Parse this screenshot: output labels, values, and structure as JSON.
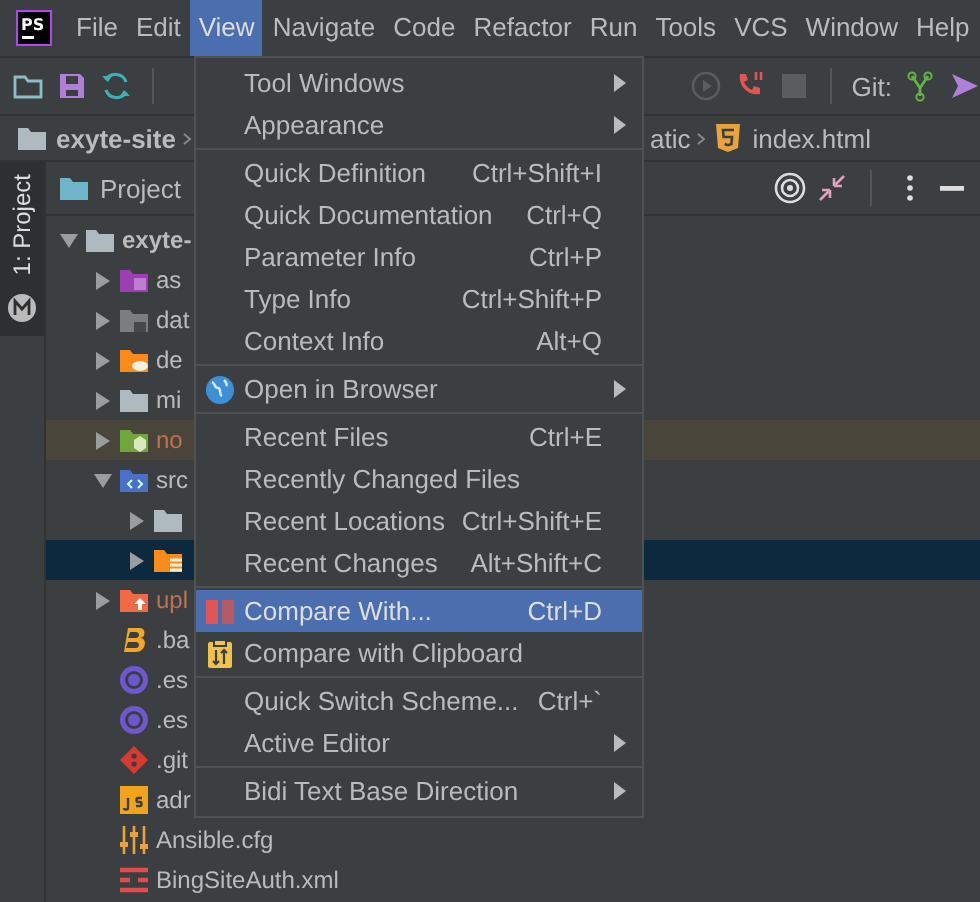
{
  "app_logo": {
    "label": "PS"
  },
  "menubar": {
    "items": [
      {
        "label": "File",
        "selected": false
      },
      {
        "label": "Edit",
        "selected": false
      },
      {
        "label": "View",
        "selected": true
      },
      {
        "label": "Navigate",
        "selected": false
      },
      {
        "label": "Code",
        "selected": false
      },
      {
        "label": "Refactor",
        "selected": false
      },
      {
        "label": "Run",
        "selected": false
      },
      {
        "label": "Tools",
        "selected": false
      },
      {
        "label": "VCS",
        "selected": false
      },
      {
        "label": "Window",
        "selected": false
      },
      {
        "label": "Help",
        "selected": false
      }
    ]
  },
  "toolbar": {
    "git_label": "Git:"
  },
  "breadcrumb": [
    {
      "label": "exyte-site",
      "kind": "project"
    },
    {
      "label": "atic",
      "kind": "plain"
    },
    {
      "label": "index.html",
      "kind": "html"
    }
  ],
  "tool_strip": {
    "tabs": [
      {
        "label": "1: Project",
        "selected": true
      }
    ]
  },
  "project_panel": {
    "title": "Project",
    "tree": [
      {
        "label": "exyte-",
        "kind": "folder",
        "expanded": true,
        "selected": false,
        "excluded": false,
        "ignored": false,
        "children": [
          {
            "label": "as",
            "kind": "resource",
            "expanded": false,
            "selected": false,
            "excluded": false,
            "ignored": false
          },
          {
            "label": "dat",
            "kind": "locked",
            "expanded": false,
            "selected": false,
            "excluded": false,
            "ignored": false
          },
          {
            "label": "de",
            "kind": "cloud",
            "expanded": false,
            "selected": false,
            "excluded": false,
            "ignored": false
          },
          {
            "label": "mi",
            "kind": "folder",
            "expanded": false,
            "selected": false,
            "excluded": false,
            "ignored": false
          },
          {
            "label": "no",
            "kind": "node",
            "expanded": false,
            "selected": false,
            "excluded": true,
            "ignored": false
          },
          {
            "label": "src",
            "kind": "source",
            "expanded": true,
            "selected": false,
            "excluded": false,
            "ignored": false,
            "children": [
              {
                "kind": "folder",
                "expanded": false,
                "selected": false,
                "excluded": false
              },
              {
                "kind": "stack",
                "expanded": false,
                "selected": true,
                "excluded": false
              }
            ]
          },
          {
            "label": "upl",
            "kind": "upload",
            "expanded": false,
            "selected": false,
            "excluded": false,
            "ignored": true
          },
          {
            "label": ".ba",
            "kind": "babel",
            "selected": false,
            "excluded": false,
            "ignored": false
          },
          {
            "label": ".es",
            "kind": "eslint",
            "selected": false,
            "excluded": false,
            "ignored": false
          },
          {
            "label": ".es",
            "kind": "eslint",
            "selected": false,
            "excluded": false,
            "ignored": false
          },
          {
            "label": ".git",
            "kind": "git",
            "selected": false,
            "excluded": false,
            "ignored": false
          },
          {
            "label": "adr",
            "kind": "js",
            "selected": false,
            "excluded": false,
            "ignored": false
          },
          {
            "label": "Ansible.cfg",
            "kind": "config",
            "selected": false,
            "excluded": false,
            "ignored": false
          },
          {
            "label": "BingSiteAuth.xml",
            "kind": "xml",
            "selected": false,
            "excluded": false,
            "ignored": false
          }
        ]
      }
    ]
  },
  "menu": {
    "items": [
      {
        "kind": "plain",
        "label": "Tool Windows",
        "submenu": true,
        "selected": false
      },
      {
        "kind": "plain",
        "label": "Appearance",
        "submenu": true,
        "selected": false
      },
      {
        "kind": "separator"
      },
      {
        "kind": "plain",
        "label": "Quick Definition",
        "shortcut": "Ctrl+Shift+I",
        "submenu": false,
        "selected": false
      },
      {
        "kind": "plain",
        "label": "Quick Documentation",
        "shortcut": "Ctrl+Q",
        "submenu": false,
        "selected": false
      },
      {
        "kind": "plain",
        "label": "Parameter Info",
        "shortcut": "Ctrl+P",
        "submenu": false,
        "selected": false
      },
      {
        "kind": "plain",
        "label": "Type Info",
        "shortcut": "Ctrl+Shift+P",
        "submenu": false,
        "selected": false
      },
      {
        "kind": "plain",
        "label": "Context Info",
        "shortcut": "Alt+Q",
        "submenu": false,
        "selected": false
      },
      {
        "kind": "separator"
      },
      {
        "kind": "globe",
        "label": "Open in Browser",
        "submenu": true,
        "selected": false
      },
      {
        "kind": "separator"
      },
      {
        "kind": "plain",
        "label": "Recent Files",
        "shortcut": "Ctrl+E",
        "submenu": false,
        "selected": false
      },
      {
        "kind": "plain",
        "label": "Recently Changed Files",
        "submenu": false,
        "selected": false
      },
      {
        "kind": "plain",
        "label": "Recent Locations",
        "shortcut": "Ctrl+Shift+E",
        "submenu": false,
        "selected": false
      },
      {
        "kind": "plain",
        "label": "Recent Changes",
        "shortcut": "Alt+Shift+C",
        "submenu": false,
        "selected": false
      },
      {
        "kind": "separator"
      },
      {
        "kind": "compare",
        "label": "Compare With...",
        "shortcut": "Ctrl+D",
        "submenu": false,
        "selected": true
      },
      {
        "kind": "clipboard",
        "label": "Compare with Clipboard",
        "submenu": false,
        "selected": false
      },
      {
        "kind": "separator"
      },
      {
        "kind": "plain",
        "label": "Quick Switch Scheme...",
        "shortcut": "Ctrl+`",
        "submenu": false,
        "selected": false
      },
      {
        "kind": "plain",
        "label": "Active Editor",
        "submenu": true,
        "selected": false
      },
      {
        "kind": "separator"
      },
      {
        "kind": "plain",
        "label": "Bidi Text Base Direction",
        "submenu": true,
        "selected": false
      }
    ]
  }
}
